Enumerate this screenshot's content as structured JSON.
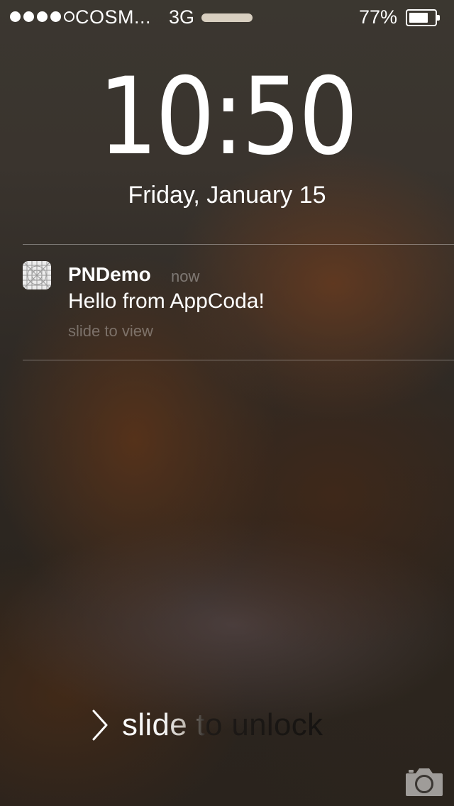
{
  "status_bar": {
    "signal_bars_filled": 4,
    "signal_bars_total": 5,
    "carrier": "COSM...",
    "network": "3G",
    "battery_percent_label": "77%",
    "battery_level": 0.77
  },
  "lock_screen": {
    "time_hours": "10",
    "time_separator": ":",
    "time_minutes": "50",
    "date": "Friday, January 15"
  },
  "notification": {
    "app_name": "PNDemo",
    "time": "now",
    "message": "Hello from AppCoda!",
    "action_hint": "slide to view",
    "icon": "app-placeholder-grid-icon"
  },
  "unlock": {
    "label": "slide to unlock",
    "icon": "chevron-right-icon"
  },
  "camera": {
    "icon": "camera-icon"
  },
  "colors": {
    "text": "#ffffff",
    "secondary_text": "#8c857c",
    "app_icon_background": "#ececec"
  }
}
